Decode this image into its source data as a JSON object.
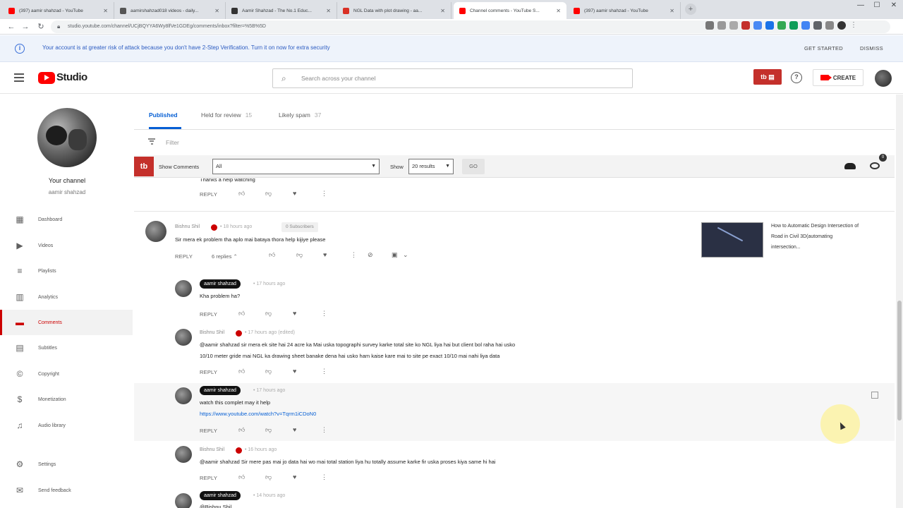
{
  "browser": {
    "tabs": [
      {
        "label": "(397) aamir shahzad - YouTube",
        "fav": "#ff0000"
      },
      {
        "label": "aamirshahzad018 videos - daily...",
        "fav": "#555555"
      },
      {
        "label": "Aamir Shahzad - The No.1 Educ...",
        "fav": "#333333"
      },
      {
        "label": "NGL Data with plot drawing - aa...",
        "fav": "#d93025"
      },
      {
        "label": "Channel comments - YouTube S...",
        "fav": "#ff0000"
      },
      {
        "label": "(397) aamir shahzad - YouTube",
        "fav": "#ff0000"
      }
    ],
    "new_tab": "+",
    "url": "studio.youtube.com/channel/UCjBQYYA6Wy8lfVe1GDEg/comments/inbox?filter=%5B%5D",
    "win_min": "—",
    "win_max": "☐",
    "win_close": "✕"
  },
  "banner": {
    "icon": "i",
    "text": "Your account is at greater risk of attack because you don't have 2-Step Verification. Turn it on now for extra security",
    "get_started": "GET STARTED",
    "dismiss": "DISMISS"
  },
  "header": {
    "studio_label": "Studio",
    "search_placeholder": "Search across your channel",
    "tb_badge": "tb ▤",
    "help": "?",
    "create_label": "CREATE"
  },
  "sidebar": {
    "channel_title": "Your channel",
    "channel_name": "aamir shahzad",
    "items": [
      {
        "label": "Dashboard",
        "icon": "▦"
      },
      {
        "label": "Videos",
        "icon": "▶"
      },
      {
        "label": "Playlists",
        "icon": "≡"
      },
      {
        "label": "Analytics",
        "icon": "▥"
      },
      {
        "label": "Comments",
        "icon": "▬"
      },
      {
        "label": "Subtitles",
        "icon": "▤"
      },
      {
        "label": "Copyright",
        "icon": "©"
      },
      {
        "label": "Monetization",
        "icon": "$"
      },
      {
        "label": "Audio library",
        "icon": "♫"
      },
      {
        "label": "Settings",
        "icon": "⚙"
      },
      {
        "label": "Send feedback",
        "icon": "✉"
      }
    ]
  },
  "comment_tabs": {
    "published": "Published",
    "held": "Held for review",
    "held_count": "15",
    "spam": "Likely spam",
    "spam_count": "37",
    "filter": "Filter"
  },
  "tubebuddy": {
    "logo": "tb",
    "show_comments_label": "Show Comments",
    "show_comments_value": "All",
    "show_label": "Show",
    "show_value": "20 results",
    "go": "GO",
    "badge": "0"
  },
  "feed": {
    "partial_text": "Thanks a help watching",
    "reply": "REPLY",
    "thread": {
      "author": "Bishnu Shil",
      "time": "18 hours ago",
      "subscribers": "0 Subscribers",
      "text": "Sir mera ek problem tha aplo mai bataya thora help kijiye please",
      "replies_toggle": "6 replies",
      "video_title": "How to Automatic Design Intersection of Road in Civil 3D(automating intersection..."
    },
    "replies": [
      {
        "author": "aamir shahzad",
        "owner": true,
        "time": "17 hours ago",
        "lines": [
          "Kha problem ha?"
        ]
      },
      {
        "author": "Bishnu Shil",
        "owner": false,
        "time": "17 hours ago (edited)",
        "lines": [
          "@aamir shahzad sir mera ek site hai 24 acre ka Mai uska topographi survey karke total site ko NGL liya hai but client bol raha hai usko",
          "10/10 meter gride mai NGL ka drawing sheet banake dena hai usko ham kaise kare mai to site pe exact 10/10 mai nahi liya data"
        ]
      },
      {
        "author": "aamir shahzad",
        "owner": true,
        "time": "17 hours ago",
        "lines": [
          "watch this complet may it help"
        ],
        "link": "https://www.youtube.com/watch?v=Tqrm1iCDoN0"
      },
      {
        "author": "Bishnu Shil",
        "owner": false,
        "time": "16 hours ago",
        "lines": [
          "@aamir shahzad Sir mere pas mai jo data hai wo mai total station liya hu totally assume karke fir uska proses kiya same hi hai"
        ]
      },
      {
        "author": "aamir shahzad",
        "owner": true,
        "time": "14 hours ago",
        "lines": [
          "@Bishnu Shil"
        ]
      }
    ]
  },
  "colors": {
    "brand_red": "#ff0000",
    "studio_blue": "#065fd4",
    "tubebuddy_red": "#c4302b"
  }
}
